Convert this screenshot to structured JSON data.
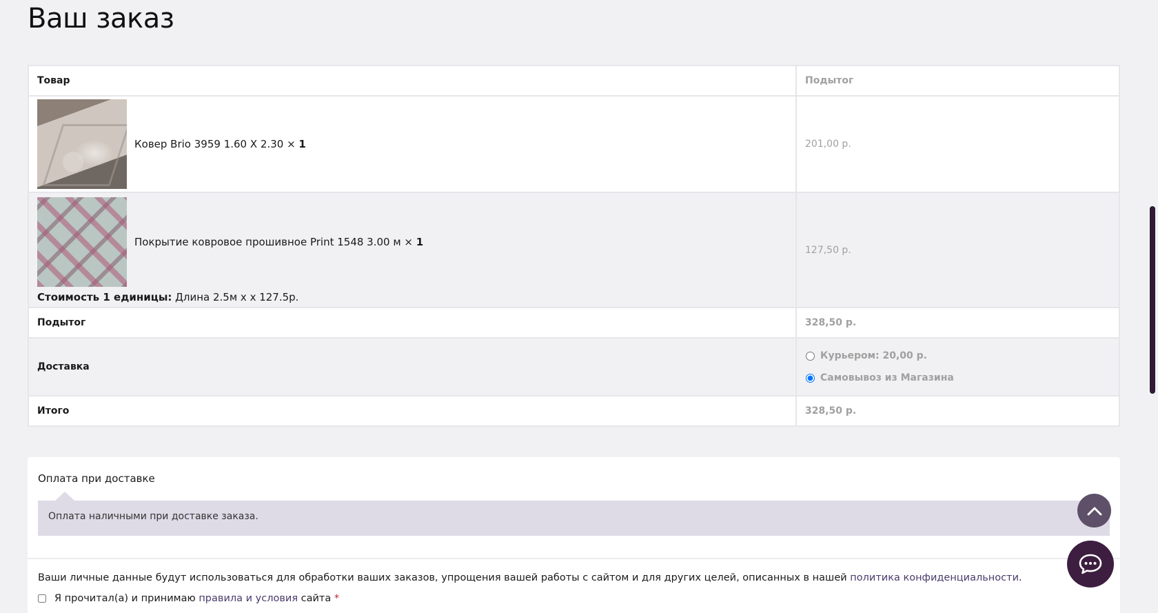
{
  "page": {
    "title": "Ваш заказ"
  },
  "order_table": {
    "header": {
      "product": "Товар",
      "subtotal": "Подытог"
    },
    "items": [
      {
        "name": "Ковер Brio 3959 1.60 X 2.30",
        "qty_prefix": " × ",
        "qty": "1",
        "subtotal": "201,00 р.",
        "image_icon": "rug-photo"
      },
      {
        "name": "Покрытие ковровое прошивное Print 1548 3.00 м",
        "qty_prefix": " × ",
        "qty": "1",
        "subtotal": "127,50 р.",
        "image_icon": "carpet-print-photo",
        "unit_cost_label": "Стоимость 1 единицы:",
        "unit_cost_value": "Длина 2.5м x x 127.5р."
      }
    ],
    "subtotal_row": {
      "label": "Подытог",
      "value": "328,50 р."
    },
    "shipping_row": {
      "label": "Доставка",
      "options": [
        {
          "label": "Курьером: 20,00 р.",
          "selected": false
        },
        {
          "label": "Самовывоз из Магазина",
          "selected": true
        }
      ]
    },
    "total_row": {
      "label": "Итого",
      "value": "328,50 р."
    }
  },
  "payment": {
    "method_label": "Оплата при доставке",
    "description": "Оплата наличными при доставке заказа."
  },
  "privacy": {
    "text": "Ваши личные данные будут использоваться для обработки ваших заказов, упрощения вашей работы с сайтом и для других целей, описанных в нашей ",
    "link_text": "политика конфиденциальности",
    "suffix": "."
  },
  "terms": {
    "prefix": "Я прочитал(а) и принимаю ",
    "link_text": "правила и условия",
    "suffix": " сайта ",
    "required_mark": "*"
  },
  "floating": {
    "scroll_top_icon": "chevron-up-icon",
    "chat_icon": "chat-bubble-icon"
  },
  "colors": {
    "page_bg": "#f1f1f3",
    "accent_dark": "#3d1e40",
    "link": "#4a3b6b",
    "payment_box_bg": "#dedbe7"
  }
}
